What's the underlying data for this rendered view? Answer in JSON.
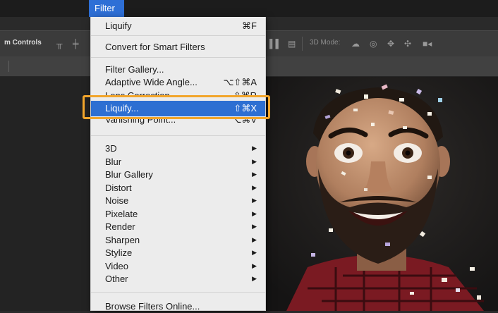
{
  "menubar": {
    "title": "Filter"
  },
  "options_bar": {
    "left_label": "m Controls",
    "mode_label": "3D Mode:"
  },
  "menu": {
    "last_filter": {
      "label": "Liquify",
      "shortcut": "⌘F"
    },
    "convert": {
      "label": "Convert for Smart Filters"
    },
    "gallery": {
      "label": "Filter Gallery..."
    },
    "adaptive": {
      "label": "Adaptive Wide Angle...",
      "shortcut": "⌥⇧⌘A"
    },
    "lens": {
      "label": "Lens Correction...",
      "shortcut": "⇧⌘R"
    },
    "liquify": {
      "label": "Liquify...",
      "shortcut": "⇧⌘X"
    },
    "vanishing": {
      "label": "Vanishing Point...",
      "shortcut": "⌥⌘V"
    },
    "submenus": [
      "3D",
      "Blur",
      "Blur Gallery",
      "Distort",
      "Noise",
      "Pixelate",
      "Render",
      "Sharpen",
      "Stylize",
      "Video",
      "Other"
    ],
    "submenu_arrow": "▶",
    "browse": {
      "label": "Browse Filters Online..."
    }
  },
  "colors": {
    "highlight": "#2d6fd2",
    "callout": "#f2a52b"
  }
}
